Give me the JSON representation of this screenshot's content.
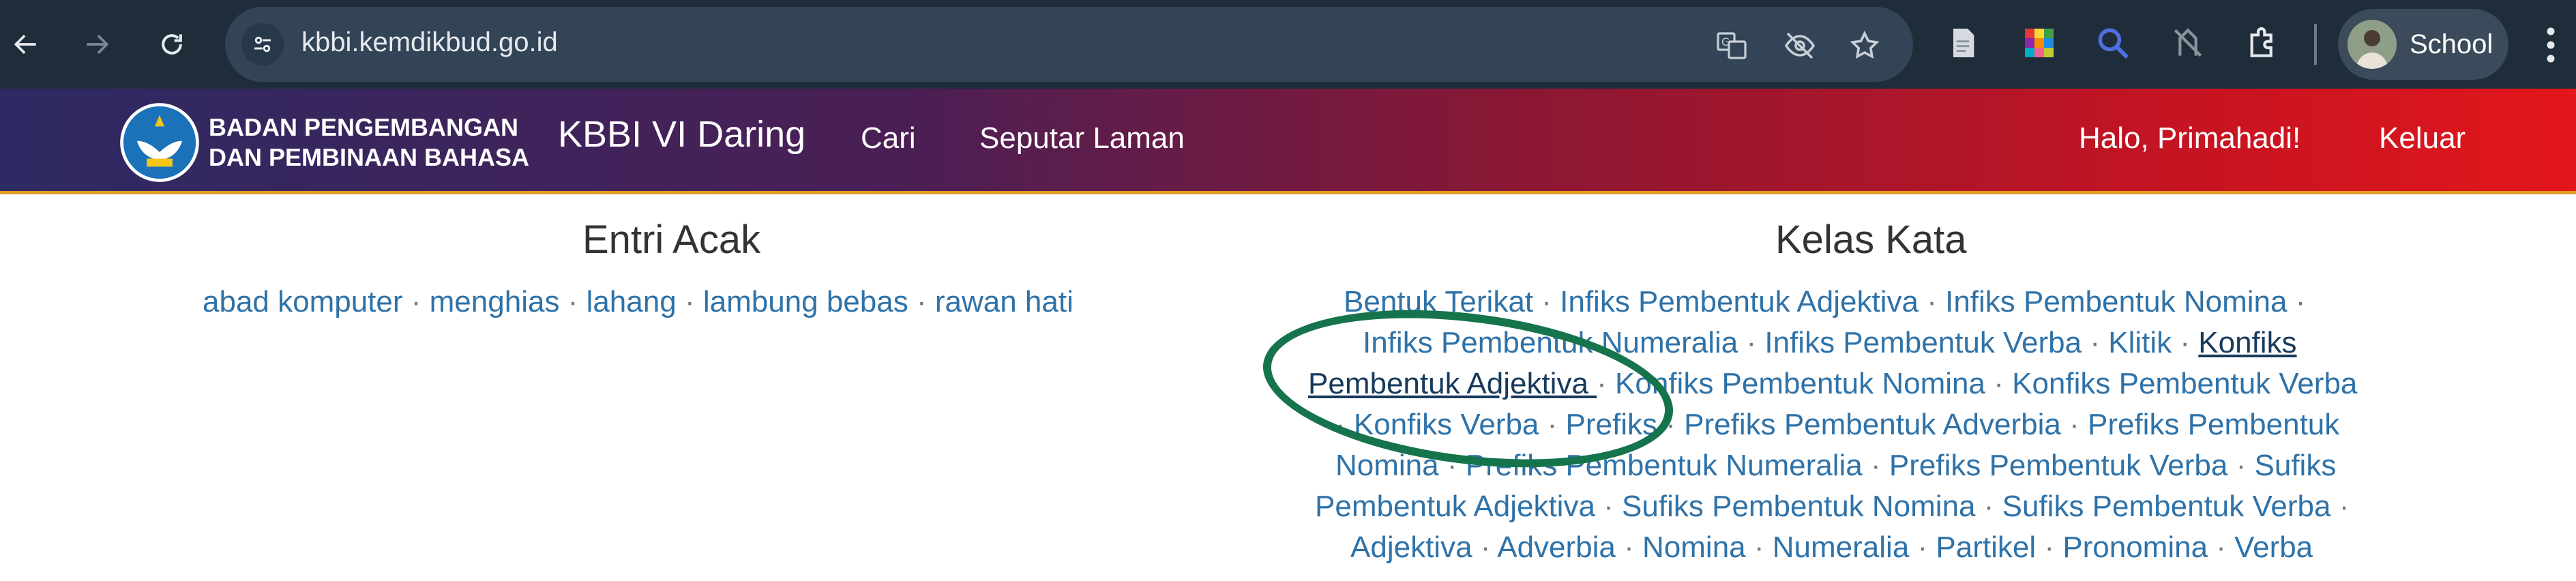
{
  "browser": {
    "url": "kbbi.kemdikbud.go.id",
    "profile_name": "School",
    "icons": {
      "back": "back-arrow-icon",
      "forward": "forward-arrow-icon",
      "reload": "reload-icon",
      "site_info": "tune-icon",
      "translate": "translate-icon",
      "eye_off": "eye-off-icon",
      "bookmark": "star-icon",
      "extensions": "puzzle-icon"
    }
  },
  "header": {
    "brand_line1": "BADAN PENGEMBANGAN",
    "brand_line2": "DAN PEMBINAAN BAHASA",
    "site_title": "KBBI VI Daring",
    "menu": [
      "Cari",
      "Seputar Laman"
    ],
    "greeting": "Halo, Primahadi!",
    "logout": "Keluar"
  },
  "entri_acak": {
    "title": "Entri Acak",
    "links": [
      "abad komputer",
      "menghias",
      "lahang",
      "lambung bebas",
      "rawan hati"
    ]
  },
  "kelas_kata": {
    "title": "Kelas Kata",
    "separator": "·",
    "lines": [
      [
        "Bentuk Terikat",
        "Infiks Pembentuk Adjektiva",
        "Infiks Pembentuk Nomina"
      ],
      [
        "Infiks Pembentuk Numeralia",
        "Infiks Pembentuk Verba",
        "Klitik",
        "Konfiks"
      ],
      [
        "Pembentuk Adjektiva ",
        "Konfiks Pembentuk Nomina",
        "Konfiks Pembentuk Verba"
      ],
      [
        "Konfiks Verba",
        "Prefiks",
        "Prefiks Pembentuk Adverbia",
        "Prefiks Pembentuk"
      ],
      [
        "Nomina",
        "Prefiks Pembentuk Numeralia",
        "Prefiks Pembentuk Verba",
        "Sufiks"
      ],
      [
        "Pembentuk Adjektiva",
        "Sufiks Pembentuk Nomina",
        "Sufiks Pembentuk Verba"
      ],
      [
        "Adjektiva",
        "Adverbia",
        "Nomina",
        "Numeralia",
        "Partikel",
        "Pronomina",
        "Verba"
      ]
    ]
  },
  "colors": {
    "link": "#2f72a8",
    "visited_link": "#173a5c",
    "annotation_circle": "#16744c",
    "header_start": "#2e2a63",
    "header_end": "#e2161b"
  }
}
